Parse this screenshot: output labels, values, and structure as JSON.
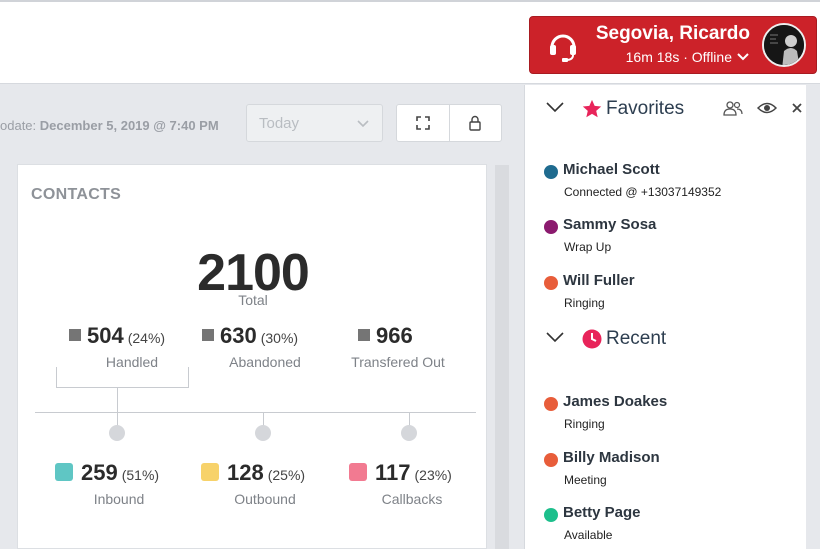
{
  "agent": {
    "name": "Segovia, Ricardo",
    "status": "16m 18s · Offline",
    "card_color": "#cc2229"
  },
  "toolbar": {
    "update_prefix": "odate:",
    "update_value": "December 5, 2019 @ 7:40 PM",
    "range_select": "Today",
    "expand_icon": "expand-icon",
    "lock_icon": "lock-icon"
  },
  "contacts_panel": {
    "title": "CONTACTS",
    "total": "2100",
    "total_label": "Total",
    "row1": [
      {
        "value": "504",
        "pct": "(24%)",
        "label": "Handled"
      },
      {
        "value": "630",
        "pct": "(30%)",
        "label": "Abandoned"
      },
      {
        "value": "966",
        "pct": "",
        "label": "Transfered Out"
      }
    ],
    "row2": [
      {
        "value": "259",
        "pct": "(51%)",
        "label": "Inbound",
        "color": "#5fc6c4"
      },
      {
        "value": "128",
        "pct": "(25%)",
        "label": "Outbound",
        "color": "#f7d26a"
      },
      {
        "value": "117",
        "pct": "(23%)",
        "label": "Callbacks",
        "color": "#f27a91"
      }
    ]
  },
  "sidebar": {
    "favorites": {
      "title": "Favorites",
      "items": [
        {
          "name": "Michael Scott",
          "status": "Connected @ +13037149352",
          "color": "#1f6b8f"
        },
        {
          "name": "Sammy Sosa",
          "status": "Wrap Up",
          "color": "#8b1a6e"
        },
        {
          "name": "Will Fuller",
          "status": "Ringing",
          "color": "#e85d3a"
        }
      ]
    },
    "recent": {
      "title": "Recent",
      "items": [
        {
          "name": "James Doakes",
          "status": "Ringing",
          "color": "#e85d3a"
        },
        {
          "name": "Billy Madison",
          "status": "Meeting",
          "color": "#e85d3a"
        },
        {
          "name": "Betty Page",
          "status": "Available",
          "color": "#1dbf8c"
        }
      ]
    }
  }
}
